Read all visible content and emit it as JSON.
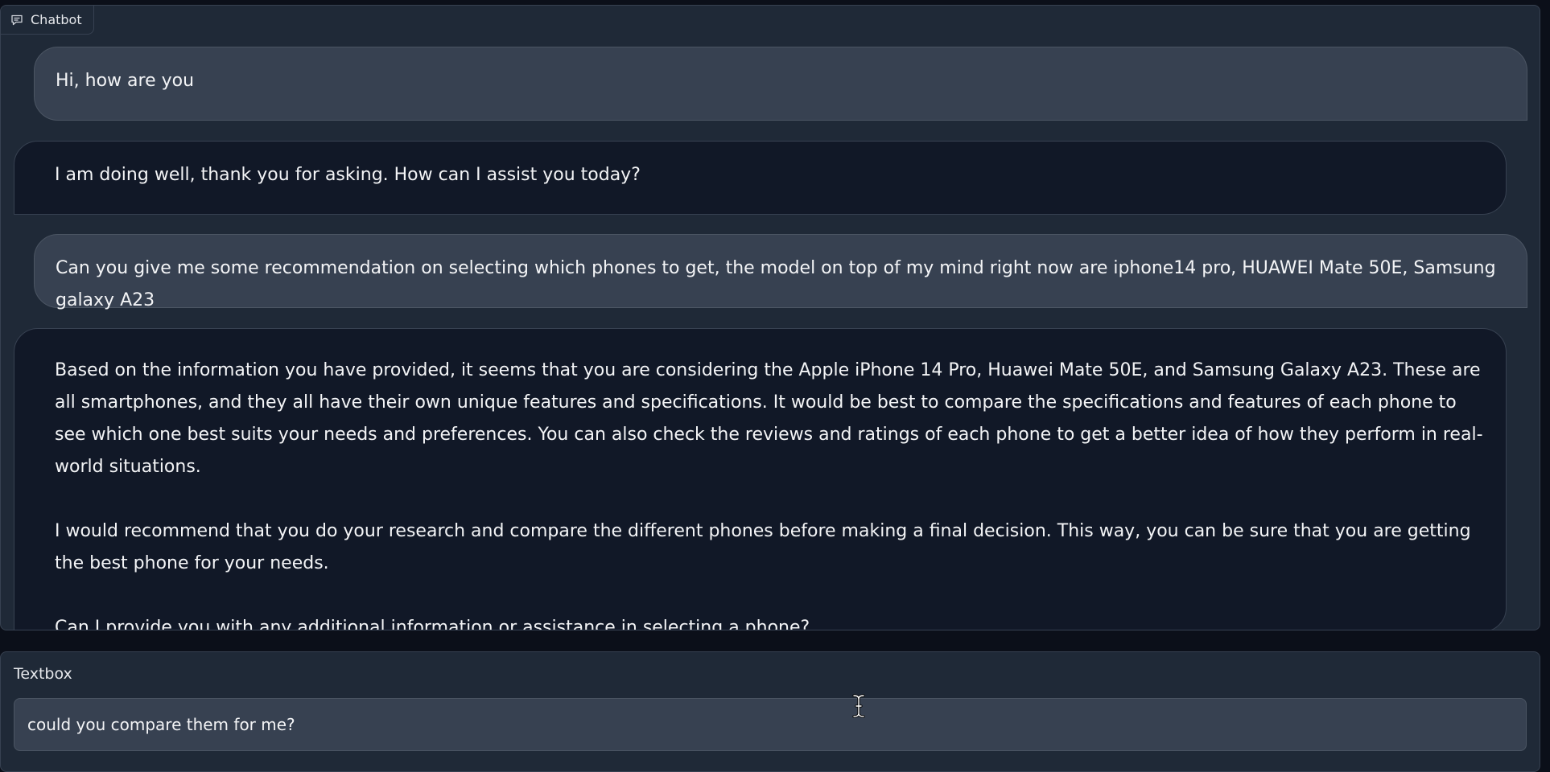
{
  "chatbot": {
    "label": "Chatbot",
    "icon": "chat-bubble-icon",
    "messages": [
      {
        "role": "user",
        "text": "Hi, how are you"
      },
      {
        "role": "bot",
        "text": "I am doing well, thank you for asking. How can I assist you today?"
      },
      {
        "role": "user",
        "text": "Can you give me some recommendation on selecting which phones to get, the model on top of my mind right now are iphone14 pro, HUAWEI Mate 50E, Samsung galaxy A23"
      },
      {
        "role": "bot",
        "paragraphs": [
          "Based on the information you have provided, it seems that you are considering the Apple iPhone 14 Pro, Huawei Mate 50E, and Samsung Galaxy A23. These are all smartphones, and they all have their own unique features and specifications. It would be best to compare the specifications and features of each phone to see which one best suits your needs and preferences. You can also check the reviews and ratings of each phone to get a better idea of how they perform in real-world situations.",
          "I would recommend that you do your research and compare the different phones before making a final decision. This way, you can be sure that you are getting the best phone for your needs.",
          "Can I provide you with any additional information or assistance in selecting a phone?"
        ]
      }
    ]
  },
  "textbox": {
    "label": "Textbox",
    "value": "could you compare them for me?"
  },
  "colors": {
    "page_background": "#0b0f19",
    "panel_background": "#1f2937",
    "user_bubble": "#374151",
    "bot_bubble": "#111827"
  }
}
